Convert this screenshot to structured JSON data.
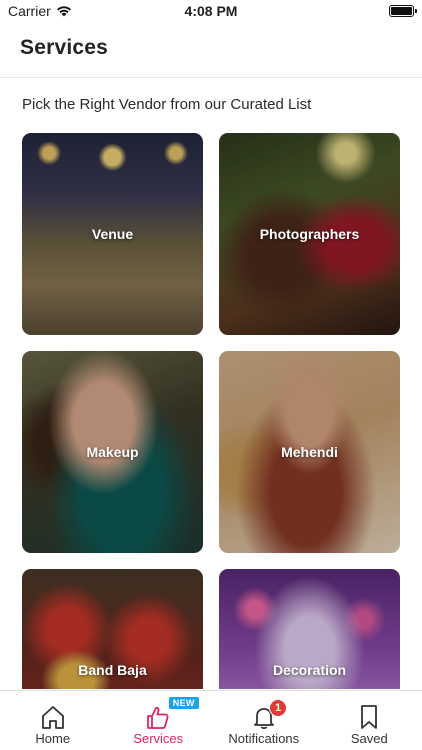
{
  "status_bar": {
    "carrier": "Carrier",
    "time": "4:08 PM"
  },
  "header": {
    "title": "Services"
  },
  "main": {
    "subtitle": "Pick the Right Vendor from our Curated List",
    "services": [
      {
        "label": "Venue"
      },
      {
        "label": "Photographers"
      },
      {
        "label": "Makeup"
      },
      {
        "label": "Mehendi"
      },
      {
        "label": "Band Baja"
      },
      {
        "label": "Decoration"
      }
    ]
  },
  "tabbar": {
    "items": [
      {
        "label": "Home",
        "icon": "home-icon"
      },
      {
        "label": "Services",
        "icon": "thumbs-up-icon",
        "badge": "NEW",
        "active": true
      },
      {
        "label": "Notifications",
        "icon": "bell-icon",
        "badge": "1"
      },
      {
        "label": "Saved",
        "icon": "bookmark-icon"
      }
    ],
    "active_color": "#e0245e",
    "new_badge_color": "#1aa3e8",
    "notification_badge_color": "#e53935"
  }
}
